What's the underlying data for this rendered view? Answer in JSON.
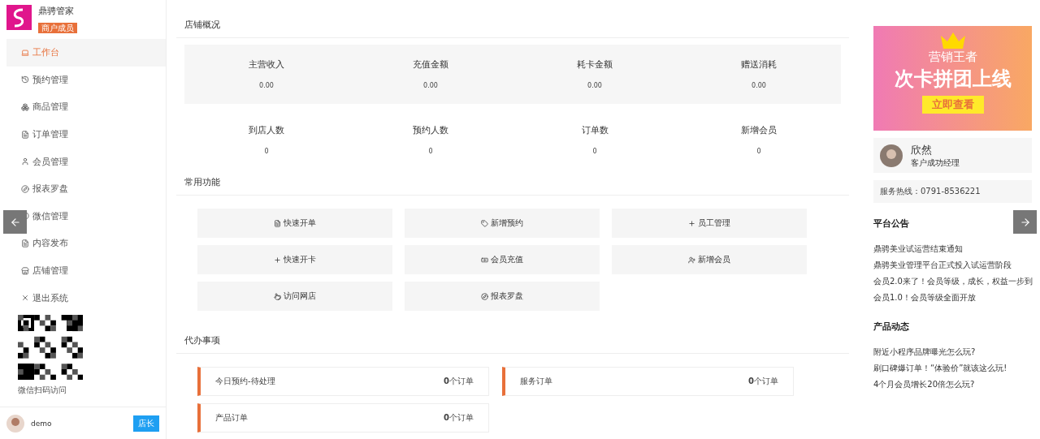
{
  "brand": {
    "name": "鼎骋管家",
    "badge": "商户成员"
  },
  "sidebar": {
    "items": [
      {
        "label": "工作台",
        "selected": true
      },
      {
        "label": "预约管理",
        "selected": false
      },
      {
        "label": "商品管理",
        "selected": false
      },
      {
        "label": "订单管理",
        "selected": false
      },
      {
        "label": "会员管理",
        "selected": false
      },
      {
        "label": "报表罗盘",
        "selected": false
      },
      {
        "label": "微信管理",
        "selected": false
      },
      {
        "label": "内容发布",
        "selected": false
      },
      {
        "label": "店铺管理",
        "selected": false
      },
      {
        "label": "退出系统",
        "selected": false
      }
    ],
    "qr_caption": "微信扫码访问",
    "user": {
      "name": "demo",
      "role": "店长"
    }
  },
  "overview": {
    "title": "店铺概况",
    "money": [
      {
        "label": "主营收入",
        "value": "0.00"
      },
      {
        "label": "充值金额",
        "value": "0.00"
      },
      {
        "label": "耗卡金额",
        "value": "0.00"
      },
      {
        "label": "赠送消耗",
        "value": "0.00"
      }
    ],
    "counts": [
      {
        "label": "到店人数",
        "value": "0"
      },
      {
        "label": "预约人数",
        "value": "0"
      },
      {
        "label": "订单数",
        "value": "0"
      },
      {
        "label": "新增会员",
        "value": "0"
      }
    ]
  },
  "shortcuts": {
    "title": "常用功能",
    "items": [
      "快速开单",
      "新增预约",
      "员工管理",
      "快速开卡",
      "会员充值",
      "新增会员",
      "访问网店",
      "报表罗盘"
    ]
  },
  "todo": {
    "title": "代办事项",
    "items": [
      {
        "label": "今日预约-待处理",
        "count": "0",
        "unit": "个订单"
      },
      {
        "label": "服务订单",
        "count": "0",
        "unit": "个订单"
      },
      {
        "label": "产品订单",
        "count": "0",
        "unit": "个订单"
      }
    ]
  },
  "banner": {
    "kicker": "营销王者",
    "headline": "次卡拼团上线",
    "button": "立即查看"
  },
  "contact": {
    "name": "欣然",
    "role": "客户成功经理",
    "hotline": "服务热线：0791-8536221"
  },
  "notices": {
    "title": "平台公告",
    "items": [
      "鼎骋美业试运营结束通知",
      "鼎骋美业管理平台正式投入试运营阶段",
      "会员2.0来了！会员等级，成长，权益一步到",
      "会员1.0！会员等级全面开放"
    ]
  },
  "news": {
    "title": "产品动态",
    "items": [
      "附近小程序品牌曝光怎么玩?",
      "刷口碑爆订单！“体验价”就该这么玩!",
      "4个月会员增长20倍怎么玩?"
    ]
  }
}
